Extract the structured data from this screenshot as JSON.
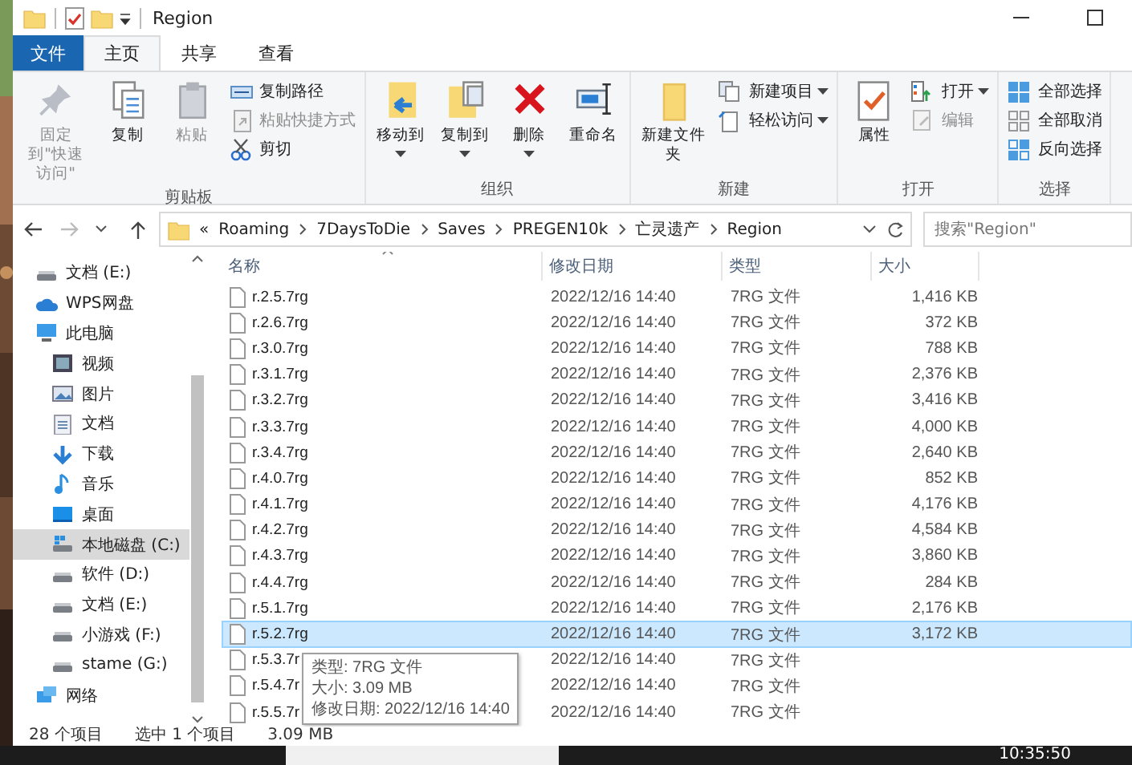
{
  "title_bar": {
    "title": "Region"
  },
  "ribbon_tabs": [
    {
      "label": "文件",
      "kind": "file",
      "selected": false
    },
    {
      "label": "主页",
      "kind": "tab",
      "selected": true
    },
    {
      "label": "共享",
      "kind": "tab",
      "selected": false
    },
    {
      "label": "查看",
      "kind": "tab",
      "selected": false
    }
  ],
  "ribbon_groups": [
    {
      "label": "剪贴板",
      "items": [
        {
          "label": "固定到\"快速访问\"",
          "kind": "large",
          "disabled": true
        },
        {
          "label": "复制",
          "kind": "large",
          "disabled": false
        },
        {
          "label": "粘贴",
          "kind": "large",
          "disabled": true
        },
        {
          "label": "复制路径",
          "kind": "small",
          "disabled": false
        },
        {
          "label": "粘贴快捷方式",
          "kind": "small",
          "disabled": true
        },
        {
          "label": "剪切",
          "kind": "small",
          "disabled": false
        }
      ]
    },
    {
      "label": "组织",
      "items": [
        {
          "label": "移动到",
          "kind": "large",
          "disabled": false,
          "dropdown": true
        },
        {
          "label": "复制到",
          "kind": "large",
          "disabled": false,
          "dropdown": true
        },
        {
          "label": "删除",
          "kind": "large",
          "disabled": false,
          "dropdown": true
        },
        {
          "label": "重命名",
          "kind": "large",
          "disabled": false
        }
      ]
    },
    {
      "label": "新建",
      "items": [
        {
          "label": "新建文件夹",
          "kind": "large",
          "disabled": false
        },
        {
          "label": "新建项目",
          "kind": "small",
          "disabled": false,
          "dropdown": true
        },
        {
          "label": "轻松访问",
          "kind": "small",
          "disabled": false,
          "dropdown": true
        }
      ]
    },
    {
      "label": "打开",
      "items": [
        {
          "label": "属性",
          "kind": "large",
          "disabled": false
        },
        {
          "label": "打开",
          "kind": "small",
          "disabled": false,
          "dropdown": true
        },
        {
          "label": "编辑",
          "kind": "small",
          "disabled": true
        }
      ]
    },
    {
      "label": "选择",
      "items": [
        {
          "label": "全部选择",
          "kind": "small",
          "disabled": false
        },
        {
          "label": "全部取消",
          "kind": "small",
          "disabled": false
        },
        {
          "label": "反向选择",
          "kind": "small",
          "disabled": false
        }
      ]
    }
  ],
  "address_bar": {
    "prefix": "«",
    "crumbs": [
      "Roaming",
      "7DaysToDie",
      "Saves",
      "PREGEN10k",
      "亡灵遗产",
      "Region"
    ],
    "search_placeholder": "搜索\"Region\""
  },
  "nav_pane": [
    {
      "label": "文档 (E:)",
      "kind": "drive",
      "selected": false
    },
    {
      "label": "WPS网盘",
      "kind": "cloud",
      "selected": false
    },
    {
      "label": "此电脑",
      "kind": "pc",
      "selected": false,
      "children": [
        {
          "label": "视频",
          "kind": "video",
          "selected": false
        },
        {
          "label": "图片",
          "kind": "pictures",
          "selected": false
        },
        {
          "label": "文档",
          "kind": "docs",
          "selected": false
        },
        {
          "label": "下载",
          "kind": "download",
          "selected": false
        },
        {
          "label": "音乐",
          "kind": "music",
          "selected": false
        },
        {
          "label": "桌面",
          "kind": "desktop",
          "selected": false
        },
        {
          "label": "本地磁盘 (C:)",
          "kind": "sysdrive",
          "selected": true
        },
        {
          "label": "软件 (D:)",
          "kind": "drive",
          "selected": false
        },
        {
          "label": "文档 (E:)",
          "kind": "drive",
          "selected": false
        },
        {
          "label": "小游戏 (F:)",
          "kind": "drive",
          "selected": false
        },
        {
          "label": "stame (G:)",
          "kind": "drive",
          "selected": false
        }
      ]
    },
    {
      "label": "网络",
      "kind": "network",
      "selected": false
    }
  ],
  "file_list": {
    "columns": [
      "名称",
      "修改日期",
      "类型",
      "大小"
    ],
    "rows": [
      {
        "name": "r.2.5.7rg",
        "modified": "2022/12/16 14:40",
        "type": "7RG 文件",
        "size": "1,416 KB",
        "selected": false
      },
      {
        "name": "r.2.6.7rg",
        "modified": "2022/12/16 14:40",
        "type": "7RG 文件",
        "size": "372 KB",
        "selected": false
      },
      {
        "name": "r.3.0.7rg",
        "modified": "2022/12/16 14:40",
        "type": "7RG 文件",
        "size": "788 KB",
        "selected": false
      },
      {
        "name": "r.3.1.7rg",
        "modified": "2022/12/16 14:40",
        "type": "7RG 文件",
        "size": "2,376 KB",
        "selected": false
      },
      {
        "name": "r.3.2.7rg",
        "modified": "2022/12/16 14:40",
        "type": "7RG 文件",
        "size": "3,416 KB",
        "selected": false
      },
      {
        "name": "r.3.3.7rg",
        "modified": "2022/12/16 14:40",
        "type": "7RG 文件",
        "size": "4,000 KB",
        "selected": false
      },
      {
        "name": "r.3.4.7rg",
        "modified": "2022/12/16 14:40",
        "type": "7RG 文件",
        "size": "2,640 KB",
        "selected": false
      },
      {
        "name": "r.4.0.7rg",
        "modified": "2022/12/16 14:40",
        "type": "7RG 文件",
        "size": "852 KB",
        "selected": false
      },
      {
        "name": "r.4.1.7rg",
        "modified": "2022/12/16 14:40",
        "type": "7RG 文件",
        "size": "4,176 KB",
        "selected": false
      },
      {
        "name": "r.4.2.7rg",
        "modified": "2022/12/16 14:40",
        "type": "7RG 文件",
        "size": "4,584 KB",
        "selected": false
      },
      {
        "name": "r.4.3.7rg",
        "modified": "2022/12/16 14:40",
        "type": "7RG 文件",
        "size": "3,860 KB",
        "selected": false
      },
      {
        "name": "r.4.4.7rg",
        "modified": "2022/12/16 14:40",
        "type": "7RG 文件",
        "size": "284 KB",
        "selected": false
      },
      {
        "name": "r.5.1.7rg",
        "modified": "2022/12/16 14:40",
        "type": "7RG 文件",
        "size": "2,176 KB",
        "selected": false
      },
      {
        "name": "r.5.2.7rg",
        "modified": "2022/12/16 14:40",
        "type": "7RG 文件",
        "size": "3,172 KB",
        "selected": true
      },
      {
        "name": "r.5.3.7r",
        "modified": "2022/12/16 14:40",
        "type": "7RG 文件",
        "selected": false
      },
      {
        "name": "r.5.4.7r",
        "modified": "2022/12/16 14:40",
        "type": "7RG 文件",
        "selected": false
      },
      {
        "name": "r.5.5.7r",
        "modified": "2022/12/16 14:40",
        "type": "7RG 文件",
        "selected": false
      }
    ]
  },
  "tooltip": [
    "类型: 7RG 文件",
    "大小: 3.09 MB",
    "修改日期: 2022/12/16 14:40"
  ],
  "status_bar": {
    "count": "28 个项目",
    "selection": "选中 1 个项目",
    "size": "3.09 MB"
  },
  "taskbar": {
    "clock": "10:35:50"
  }
}
